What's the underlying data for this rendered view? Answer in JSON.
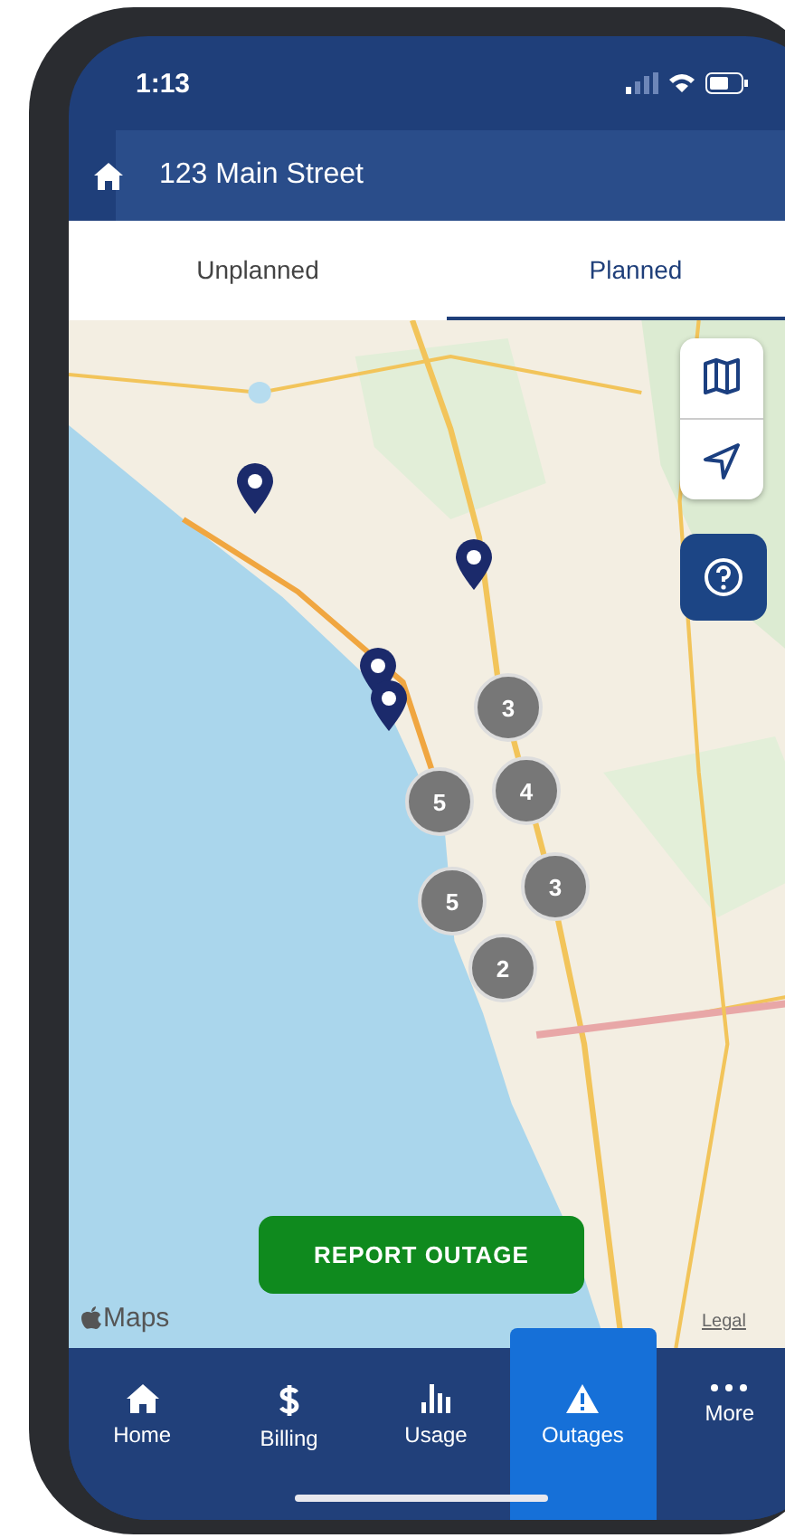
{
  "status_bar": {
    "time": "1:13"
  },
  "header": {
    "title": "123 Main Street"
  },
  "tabs": [
    {
      "label": "Unplanned",
      "selected": false
    },
    {
      "label": "Planned",
      "selected": true
    }
  ],
  "map": {
    "clusters": [
      {
        "count": "3"
      },
      {
        "count": "4"
      },
      {
        "count": "5"
      },
      {
        "count": "5"
      },
      {
        "count": "3"
      },
      {
        "count": "2"
      }
    ],
    "report_button": "REPORT OUTAGE",
    "attribution": "Maps",
    "legal": "Legal"
  },
  "nav": [
    {
      "kind": "home",
      "label": "Home",
      "selected": false
    },
    {
      "kind": "billing",
      "label": "Billing",
      "selected": false
    },
    {
      "kind": "usage",
      "label": "Usage",
      "selected": false
    },
    {
      "kind": "outages",
      "label": "Outages",
      "selected": true
    },
    {
      "kind": "more",
      "label": "More",
      "selected": false
    }
  ]
}
